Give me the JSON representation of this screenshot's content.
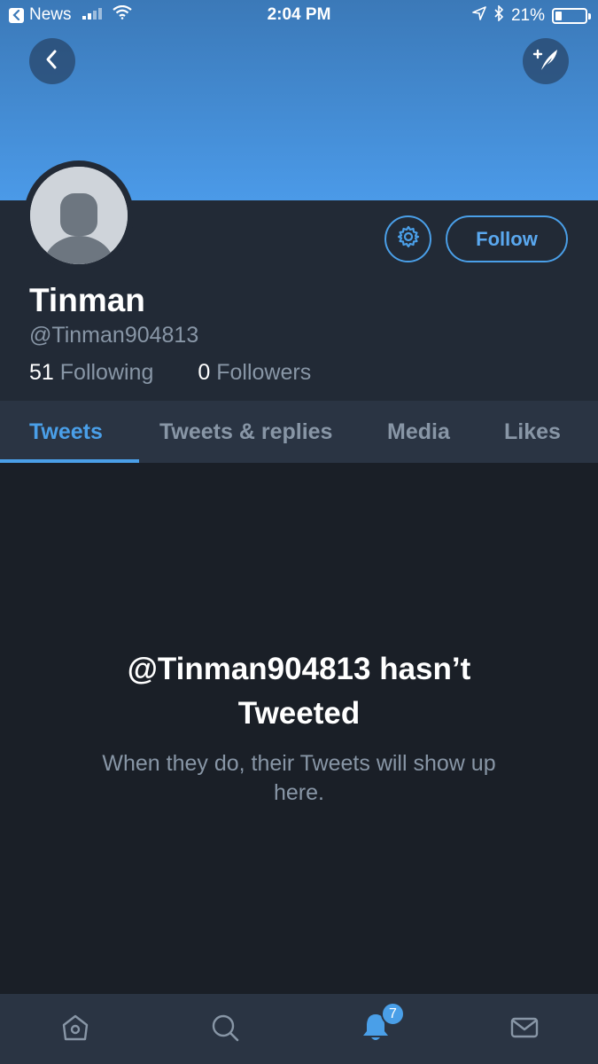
{
  "status_bar": {
    "back_app": "News",
    "time": "2:04 PM",
    "battery": "21%",
    "battery_level": 0.21
  },
  "header": {
    "back_icon": "chevron-left-icon",
    "compose_icon": "compose-tweet-icon"
  },
  "profile": {
    "name": "Tinman",
    "handle": "@Tinman904813",
    "following_count": "51",
    "following_label": "Following",
    "followers_count": "0",
    "followers_label": "Followers",
    "follow_label": "Follow",
    "settings_icon": "gear-icon"
  },
  "tabs": [
    {
      "label": "Tweets",
      "active": true
    },
    {
      "label": "Tweets & replies",
      "active": false
    },
    {
      "label": "Media",
      "active": false
    },
    {
      "label": "Likes",
      "active": false
    }
  ],
  "empty_state": {
    "title_line1": "@Tinman904813 hasn’t",
    "title_line2": "Tweeted",
    "subtitle_line1": "When they do, their Tweets will show up",
    "subtitle_line2": "here."
  },
  "bottom_nav": {
    "items": [
      "home-icon",
      "search-icon",
      "notifications-icon",
      "messages-icon"
    ],
    "notifications_badge": "7"
  },
  "colors": {
    "accent": "#4a9fe8",
    "background": "#1a1f27",
    "panel": "#222a36",
    "tabbar": "#2a3443",
    "muted_text": "#8896a6"
  }
}
